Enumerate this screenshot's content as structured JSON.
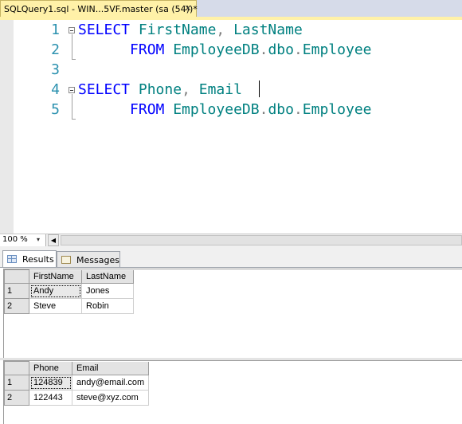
{
  "document_tab": {
    "title": "SQLQuery1.sql - WIN...5VF.master (sa (54))*",
    "close_glyph": "✕"
  },
  "editor": {
    "lines": [
      {
        "number": "1",
        "tokens": [
          {
            "text": "SELECT",
            "kind": "keyword"
          },
          {
            "text": " FirstName",
            "kind": "identifier"
          },
          {
            "text": ",",
            "kind": "punct"
          },
          {
            "text": " LastName",
            "kind": "identifier"
          }
        ]
      },
      {
        "number": "2",
        "tokens": [
          {
            "text": "      FROM",
            "kind": "keyword"
          },
          {
            "text": " EmployeeDB",
            "kind": "identifier"
          },
          {
            "text": ".",
            "kind": "punct"
          },
          {
            "text": "dbo",
            "kind": "identifier"
          },
          {
            "text": ".",
            "kind": "punct"
          },
          {
            "text": "Employee",
            "kind": "identifier"
          }
        ]
      },
      {
        "number": "3",
        "tokens": []
      },
      {
        "number": "4",
        "tokens": [
          {
            "text": "SELECT",
            "kind": "keyword"
          },
          {
            "text": " Phone",
            "kind": "identifier"
          },
          {
            "text": ",",
            "kind": "punct"
          },
          {
            "text": " Email",
            "kind": "identifier"
          }
        ]
      },
      {
        "number": "5",
        "tokens": [
          {
            "text": "      FROM",
            "kind": "keyword"
          },
          {
            "text": " EmployeeDB",
            "kind": "identifier"
          },
          {
            "text": ".",
            "kind": "punct"
          },
          {
            "text": "dbo",
            "kind": "identifier"
          },
          {
            "text": ".",
            "kind": "punct"
          },
          {
            "text": "Employee",
            "kind": "identifier"
          }
        ]
      }
    ],
    "colors": {
      "keyword": "#0000ff",
      "identifier": "#008080",
      "punct": "#808080",
      "line_number": "#2b91af"
    }
  },
  "zoom": {
    "value": "100 %",
    "dropdown_glyph": "▾",
    "scroll_left_glyph": "◀"
  },
  "results_tabs": [
    {
      "label": "Results",
      "icon": "grid-icon",
      "active": true
    },
    {
      "label": "Messages",
      "icon": "messages-icon",
      "active": false
    }
  ],
  "grids": [
    {
      "columns": [
        "FirstName",
        "LastName"
      ],
      "rows": [
        {
          "num": "1",
          "cells": [
            "Andy",
            "Jones"
          ]
        },
        {
          "num": "2",
          "cells": [
            "Steve",
            "Robin"
          ]
        }
      ]
    },
    {
      "columns": [
        "Phone",
        "Email"
      ],
      "rows": [
        {
          "num": "1",
          "cells": [
            "124839",
            "andy@email.com"
          ]
        },
        {
          "num": "2",
          "cells": [
            "122443",
            "steve@xyz.com"
          ]
        }
      ]
    }
  ]
}
